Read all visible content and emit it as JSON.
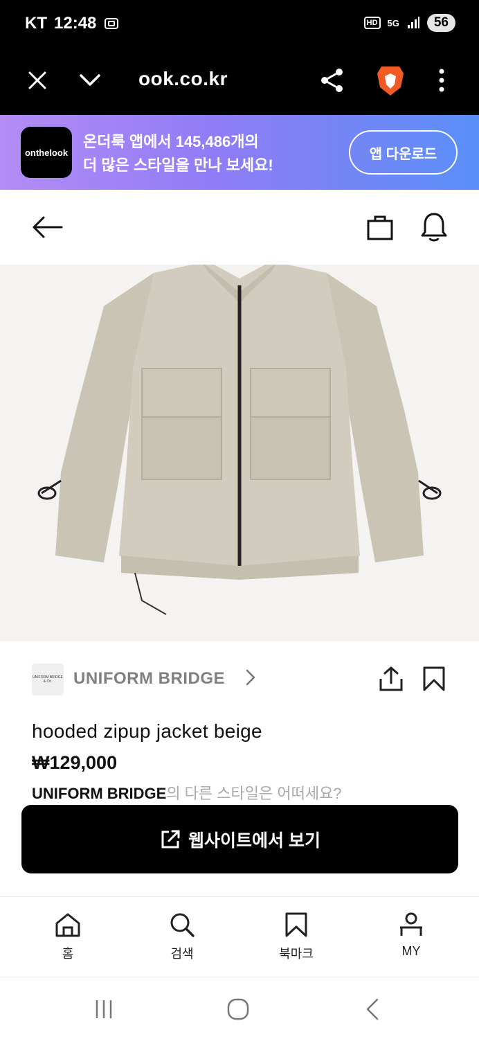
{
  "status_bar": {
    "carrier": "KT",
    "time": "12:48",
    "network": "5G",
    "hd_badge": "HD",
    "battery": "56"
  },
  "browser": {
    "url": "ook.co.kr"
  },
  "app_banner": {
    "logo_text": "onthelook",
    "line1": "온더룩 앱에서 145,486개의",
    "line2": "더 많은 스타일을 만나 보세요!",
    "download_label": "앱 다운로드"
  },
  "brand": {
    "name": "UNIFORM BRIDGE",
    "logo_text": "UNIFORM BRIDGE & Co."
  },
  "product": {
    "title": "hooded zipup jacket beige",
    "price": "₩129,000",
    "other_brand": "UNIFORM BRIDGE",
    "other_suffix": "의 다른 스타일은 어떠세요?",
    "cta_label": "웹사이트에서 보기"
  },
  "bottom_nav": {
    "items": [
      {
        "label": "홈",
        "icon": "home-icon"
      },
      {
        "label": "검색",
        "icon": "search-icon"
      },
      {
        "label": "북마크",
        "icon": "bookmark-icon"
      },
      {
        "label": "MY",
        "icon": "person-icon"
      }
    ]
  },
  "colors": {
    "banner_start": "#b58cf5",
    "banner_end": "#5a8ff7",
    "brave_orange": "#f05a24",
    "cta": "#000000"
  }
}
